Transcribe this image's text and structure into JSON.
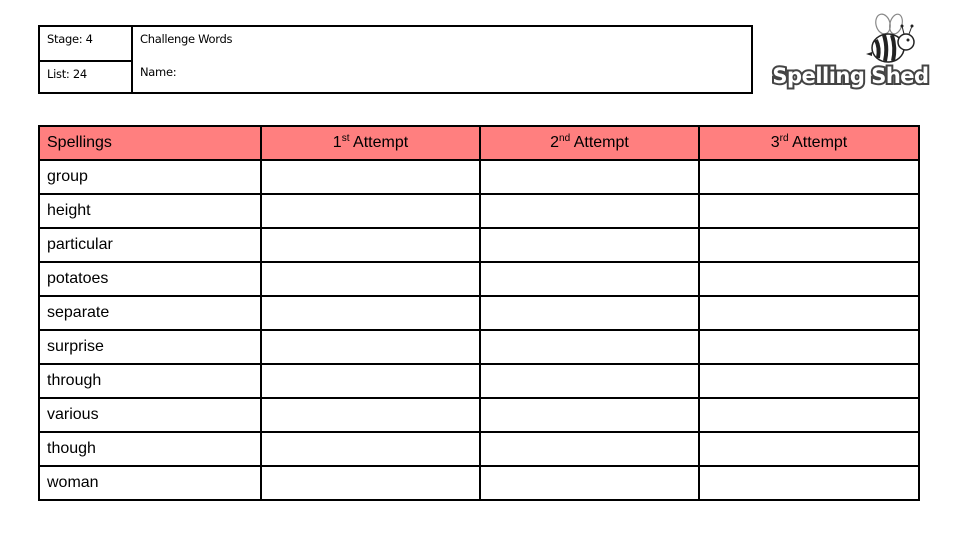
{
  "info": {
    "stage_label": "Stage: 4",
    "list_label": "List: 24",
    "title": "Challenge Words",
    "name_label": "Name:"
  },
  "logo": {
    "text": "Spelling Shed",
    "icon": "bee-icon"
  },
  "table": {
    "header_color": "#FF7F7F",
    "columns": [
      {
        "label": "Spellings"
      },
      {
        "num": "1",
        "sup": "st",
        "label": " Attempt"
      },
      {
        "num": "2",
        "sup": "nd",
        "label": " Attempt"
      },
      {
        "num": "3",
        "sup": "rd",
        "label": " Attempt"
      }
    ],
    "words": [
      "group",
      "height",
      "particular",
      "potatoes",
      "separate",
      "surprise",
      "through",
      "various",
      "though",
      "woman"
    ]
  }
}
